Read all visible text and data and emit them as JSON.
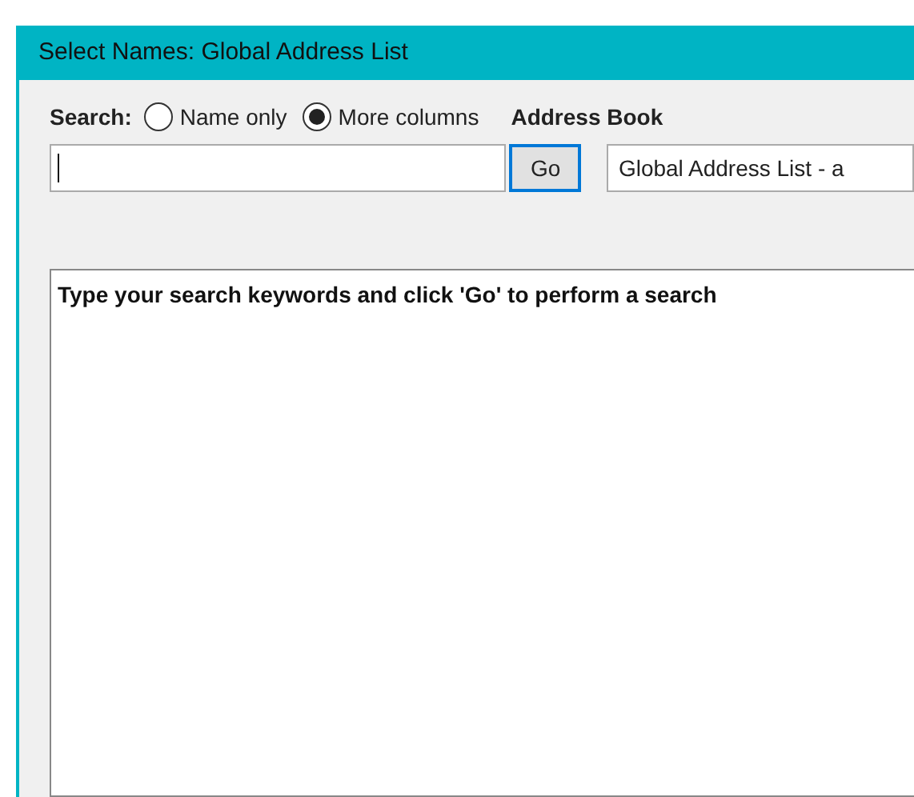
{
  "window": {
    "title": "Select Names: Global Address List"
  },
  "search": {
    "label": "Search:",
    "options": [
      {
        "label": "Name only",
        "selected": false
      },
      {
        "label": "More columns",
        "selected": true
      }
    ],
    "button": "Go"
  },
  "address_book": {
    "label": "Address Book",
    "value": "Global Address List - a"
  },
  "results": {
    "message": "Type your search keywords and click 'Go' to perform a search"
  }
}
